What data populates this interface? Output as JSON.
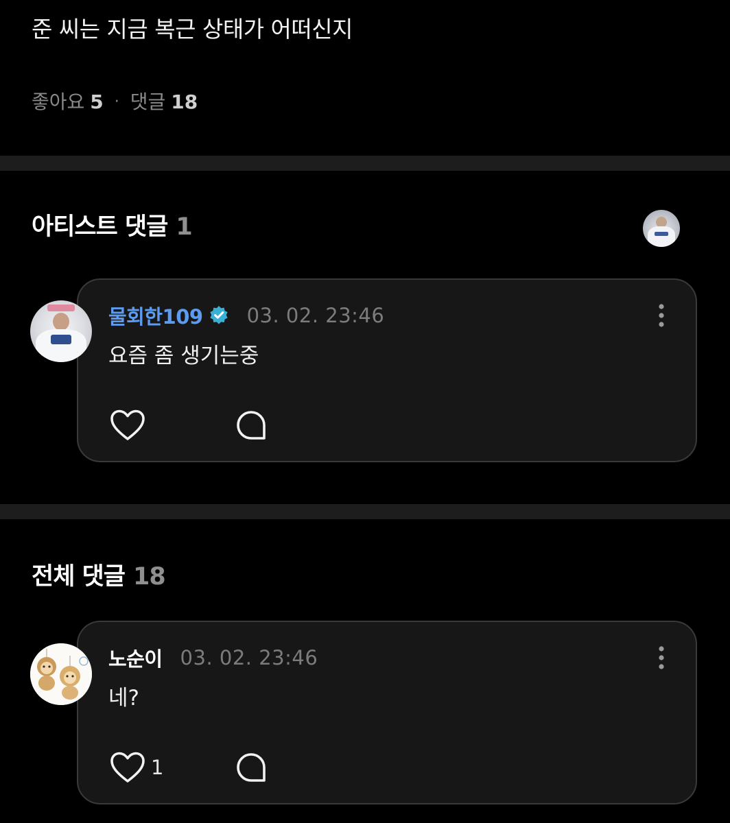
{
  "post": {
    "title": "준 씨는 지금 복근 상태가 어떠신지",
    "likes_label": "좋아요",
    "likes_count": "5",
    "separator": "·",
    "comments_label": "댓글",
    "comments_count": "18"
  },
  "artist_section": {
    "title": "아티스트 댓글",
    "count": "1",
    "comment": {
      "username": "물회한109",
      "verified": true,
      "timestamp": "03. 02. 23:46",
      "body": "요즘 좀 생기는중",
      "like_count": ""
    }
  },
  "all_section": {
    "title": "전체 댓글",
    "count": "18",
    "comments": [
      {
        "username": "노순이",
        "timestamp": "03. 02. 23:46",
        "body": "네?",
        "like_count": "1"
      }
    ]
  },
  "colors": {
    "background": "#000000",
    "card": "#171717",
    "card_border": "#3a3a3a",
    "artist_name": "#5c9bf0",
    "verified_badge": "#3bb0d6",
    "muted_text": "#7c7c7c",
    "divider": "#1d1d1d"
  },
  "icons": {
    "verified": "verified-badge-icon",
    "more": "more-vertical-icon",
    "like": "heart-icon",
    "reply": "speech-bubble-icon"
  }
}
